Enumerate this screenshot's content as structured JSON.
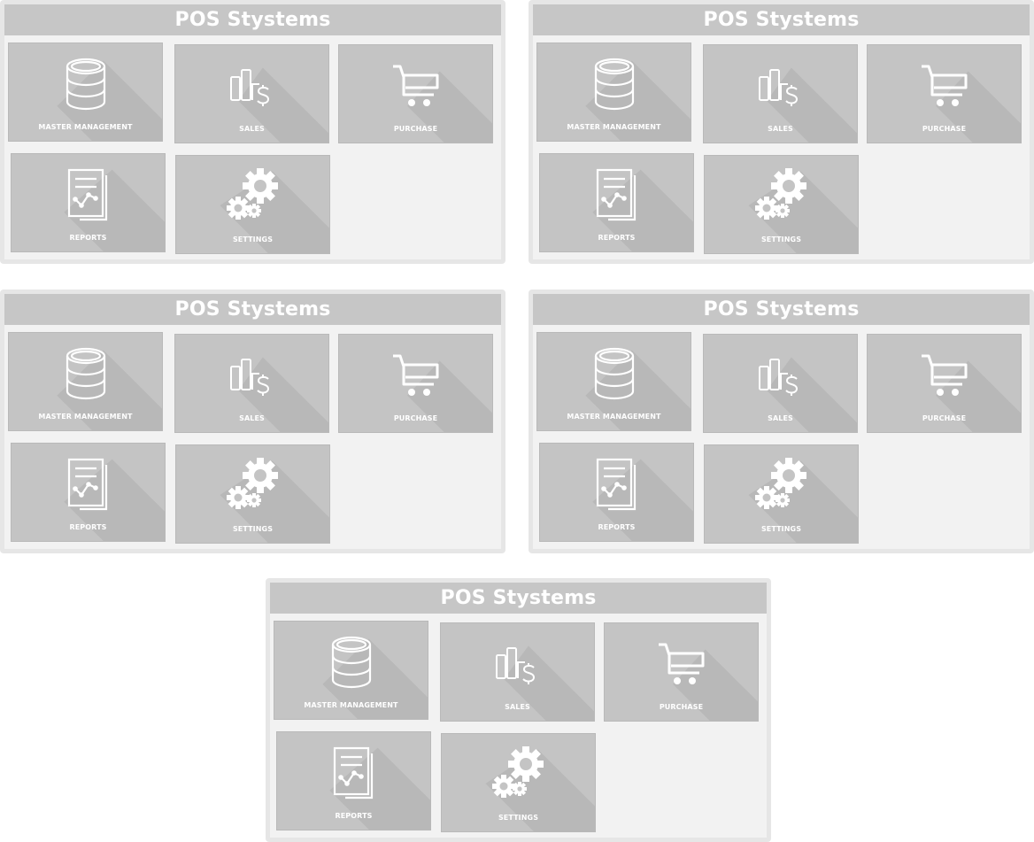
{
  "panels": [
    {
      "title": "POS Stystems",
      "tiles": [
        {
          "id": "master",
          "label": "MASTER MANAGEMENT",
          "icon": "database-icon"
        },
        {
          "id": "sales",
          "label": "SALES",
          "icon": "sales-chart-dollar-icon"
        },
        {
          "id": "purchase",
          "label": "PURCHASE",
          "icon": "shopping-cart-icon"
        },
        {
          "id": "reports",
          "label": "REPORTS",
          "icon": "report-document-icon"
        },
        {
          "id": "settings",
          "label": "SETTINGS",
          "icon": "gears-icon"
        }
      ]
    },
    {
      "title": "POS Stystems",
      "tiles": [
        {
          "id": "master",
          "label": "MASTER MANAGEMENT",
          "icon": "database-icon"
        },
        {
          "id": "sales",
          "label": "SALES",
          "icon": "sales-chart-dollar-icon"
        },
        {
          "id": "purchase",
          "label": "PURCHASE",
          "icon": "shopping-cart-icon"
        },
        {
          "id": "reports",
          "label": "REPORTS",
          "icon": "report-document-icon"
        },
        {
          "id": "settings",
          "label": "SETTINGS",
          "icon": "gears-icon"
        }
      ]
    },
    {
      "title": "POS Stystems",
      "tiles": [
        {
          "id": "master",
          "label": "MASTER MANAGEMENT",
          "icon": "database-icon"
        },
        {
          "id": "sales",
          "label": "SALES",
          "icon": "sales-chart-dollar-icon"
        },
        {
          "id": "purchase",
          "label": "PURCHASE",
          "icon": "shopping-cart-icon"
        },
        {
          "id": "reports",
          "label": "REPORTS",
          "icon": "report-document-icon"
        },
        {
          "id": "settings",
          "label": "SETTINGS",
          "icon": "gears-icon"
        }
      ]
    },
    {
      "title": "POS Stystems",
      "tiles": [
        {
          "id": "master",
          "label": "MASTER MANAGEMENT",
          "icon": "database-icon"
        },
        {
          "id": "sales",
          "label": "SALES",
          "icon": "sales-chart-dollar-icon"
        },
        {
          "id": "purchase",
          "label": "PURCHASE",
          "icon": "shopping-cart-icon"
        },
        {
          "id": "reports",
          "label": "REPORTS",
          "icon": "report-document-icon"
        },
        {
          "id": "settings",
          "label": "SETTINGS",
          "icon": "gears-icon"
        }
      ]
    },
    {
      "title": "POS Stystems",
      "tiles": [
        {
          "id": "master",
          "label": "MASTER MANAGEMENT",
          "icon": "database-icon"
        },
        {
          "id": "sales",
          "label": "SALES",
          "icon": "sales-chart-dollar-icon"
        },
        {
          "id": "purchase",
          "label": "PURCHASE",
          "icon": "shopping-cart-icon"
        },
        {
          "id": "reports",
          "label": "REPORTS",
          "icon": "report-document-icon"
        },
        {
          "id": "settings",
          "label": "SETTINGS",
          "icon": "gears-icon"
        }
      ]
    }
  ],
  "colors": {
    "page_bg": "#ffffff",
    "panel_bg": "#f2f2f2",
    "panel_border": "#e6e6e6",
    "header_bg": "#c6c6c6",
    "tile_bg": "#c4c4c4",
    "tile_shadow": "#b8b8b8",
    "text": "#ffffff"
  }
}
